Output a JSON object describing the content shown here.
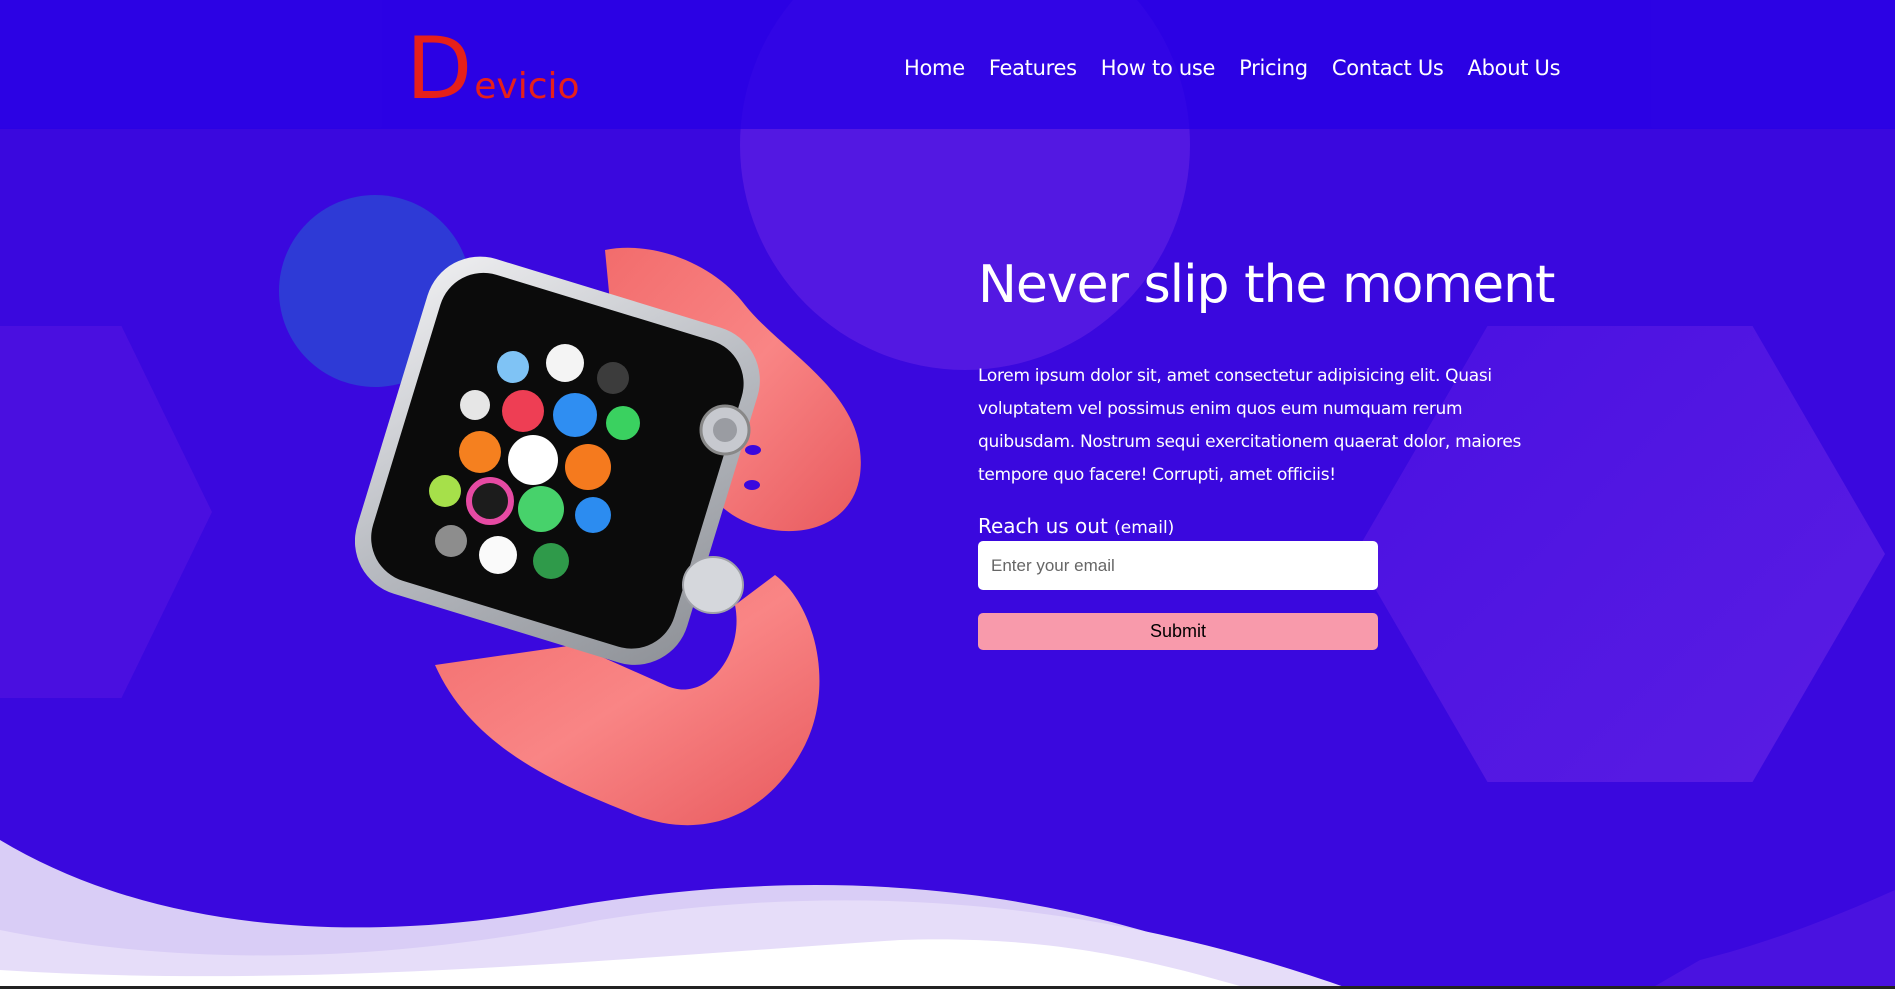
{
  "brand": {
    "initial": "D",
    "rest": "evicio",
    "color": "#e6201a"
  },
  "nav": {
    "items": [
      {
        "label": "Home"
      },
      {
        "label": "Features"
      },
      {
        "label": "How to use"
      },
      {
        "label": "Pricing"
      },
      {
        "label": "Contact Us"
      },
      {
        "label": "About Us"
      }
    ]
  },
  "hero": {
    "title": "Never slip the moment",
    "text": "Lorem ipsum dolor sit, amet consectetur adipisicing elit. Quasi voluptatem vel possimus enim quos eum numquam rerum quibusdam. Nostrum sequi exercitationem quaerat dolor, maiores tempore quo facere! Corrupti, amet officiis!",
    "product_image": "pink-smartwatch-illustration"
  },
  "form": {
    "label": "Reach us out",
    "label_hint": "(email)",
    "email_placeholder": "Enter your email",
    "submit_label": "Submit"
  },
  "colors": {
    "background": "#3a08de",
    "navbar": "#2800e6",
    "submit_button": "#f89aab",
    "watch_band": "#f47a7a"
  }
}
